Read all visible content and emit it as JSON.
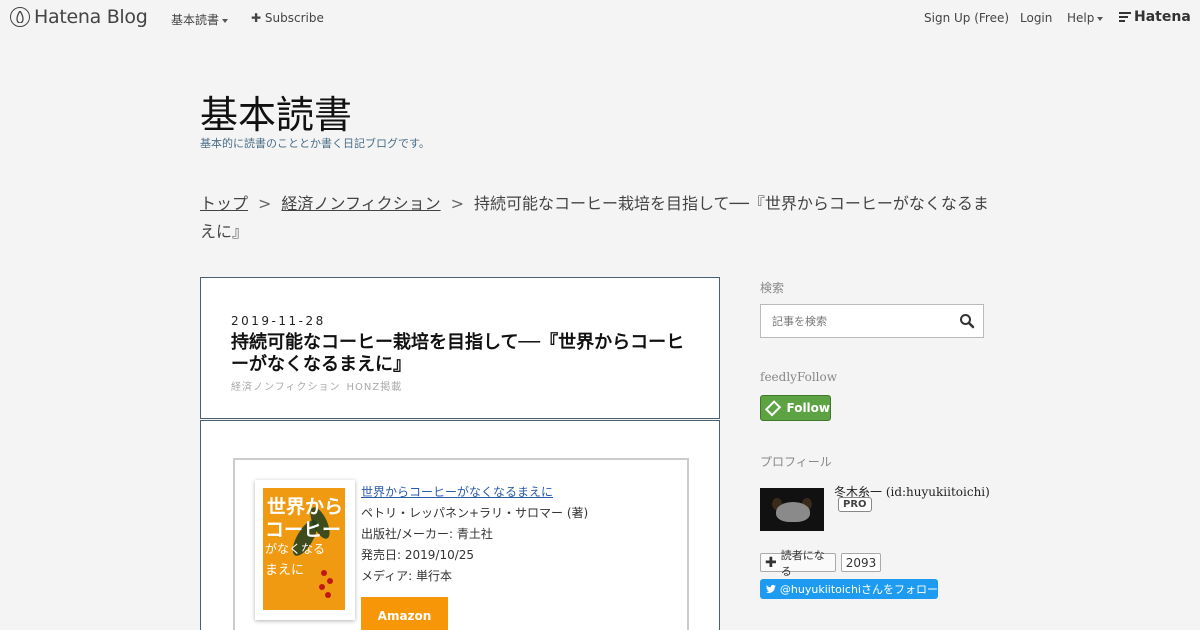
{
  "global_header": {
    "logo_text": "Hatena Blog",
    "menu_label": "基本読書",
    "subscribe_label": "Subscribe",
    "signup_label": "Sign Up (Free)",
    "login_label": "Login",
    "help_label": "Help",
    "hatena_label": "Hatena"
  },
  "blog": {
    "title": "基本読書",
    "description": "基本的に読書のこととか書く日記ブログです。"
  },
  "breadcrumb": {
    "top_label": "トップ",
    "sep1": ">",
    "category_label": "経済ノンフィクション",
    "sep2": ">",
    "current": "持続可能なコーヒー栽培を目指して──『世界からコーヒーがなくなるまえに』"
  },
  "entry": {
    "date": "2019-11-28",
    "title": "持続可能なコーヒー栽培を目指して──『世界からコーヒーがなくなるまえに』",
    "categories": [
      "経済ノンフィクション",
      "HONZ掲載"
    ]
  },
  "book": {
    "title": "世界からコーヒーがなくなるまえに",
    "author": "ペトリ・レッパネン+ラリ・サロマー (著)",
    "publisher": "出版社/メーカー: 青土社",
    "release": "発売日: 2019/10/25",
    "media": "メディア: 単行本",
    "buy_label": "Amazon",
    "cover": {
      "line1": "世界から",
      "line2": "コーヒー",
      "line3": "がなくなる",
      "line4": "まえに"
    }
  },
  "sidebar": {
    "search_heading": "検索",
    "search_placeholder": "記事を検索",
    "feedly_heading": "feedlyFollow",
    "feedly_label": "Follow",
    "profile_heading": "プロフィール",
    "profile_name": "冬木糸一 (id:huyukiitoichi)",
    "profile_badge": "PRO",
    "reader_label": "読者になる",
    "reader_count": "2093",
    "twitter_label": "@huyukiitoichiさんをフォロー"
  },
  "colors": {
    "amazon": "#f79606",
    "feedly": "#5da344",
    "twitter": "#1d9bf0",
    "book_cover": "#f09a12"
  }
}
